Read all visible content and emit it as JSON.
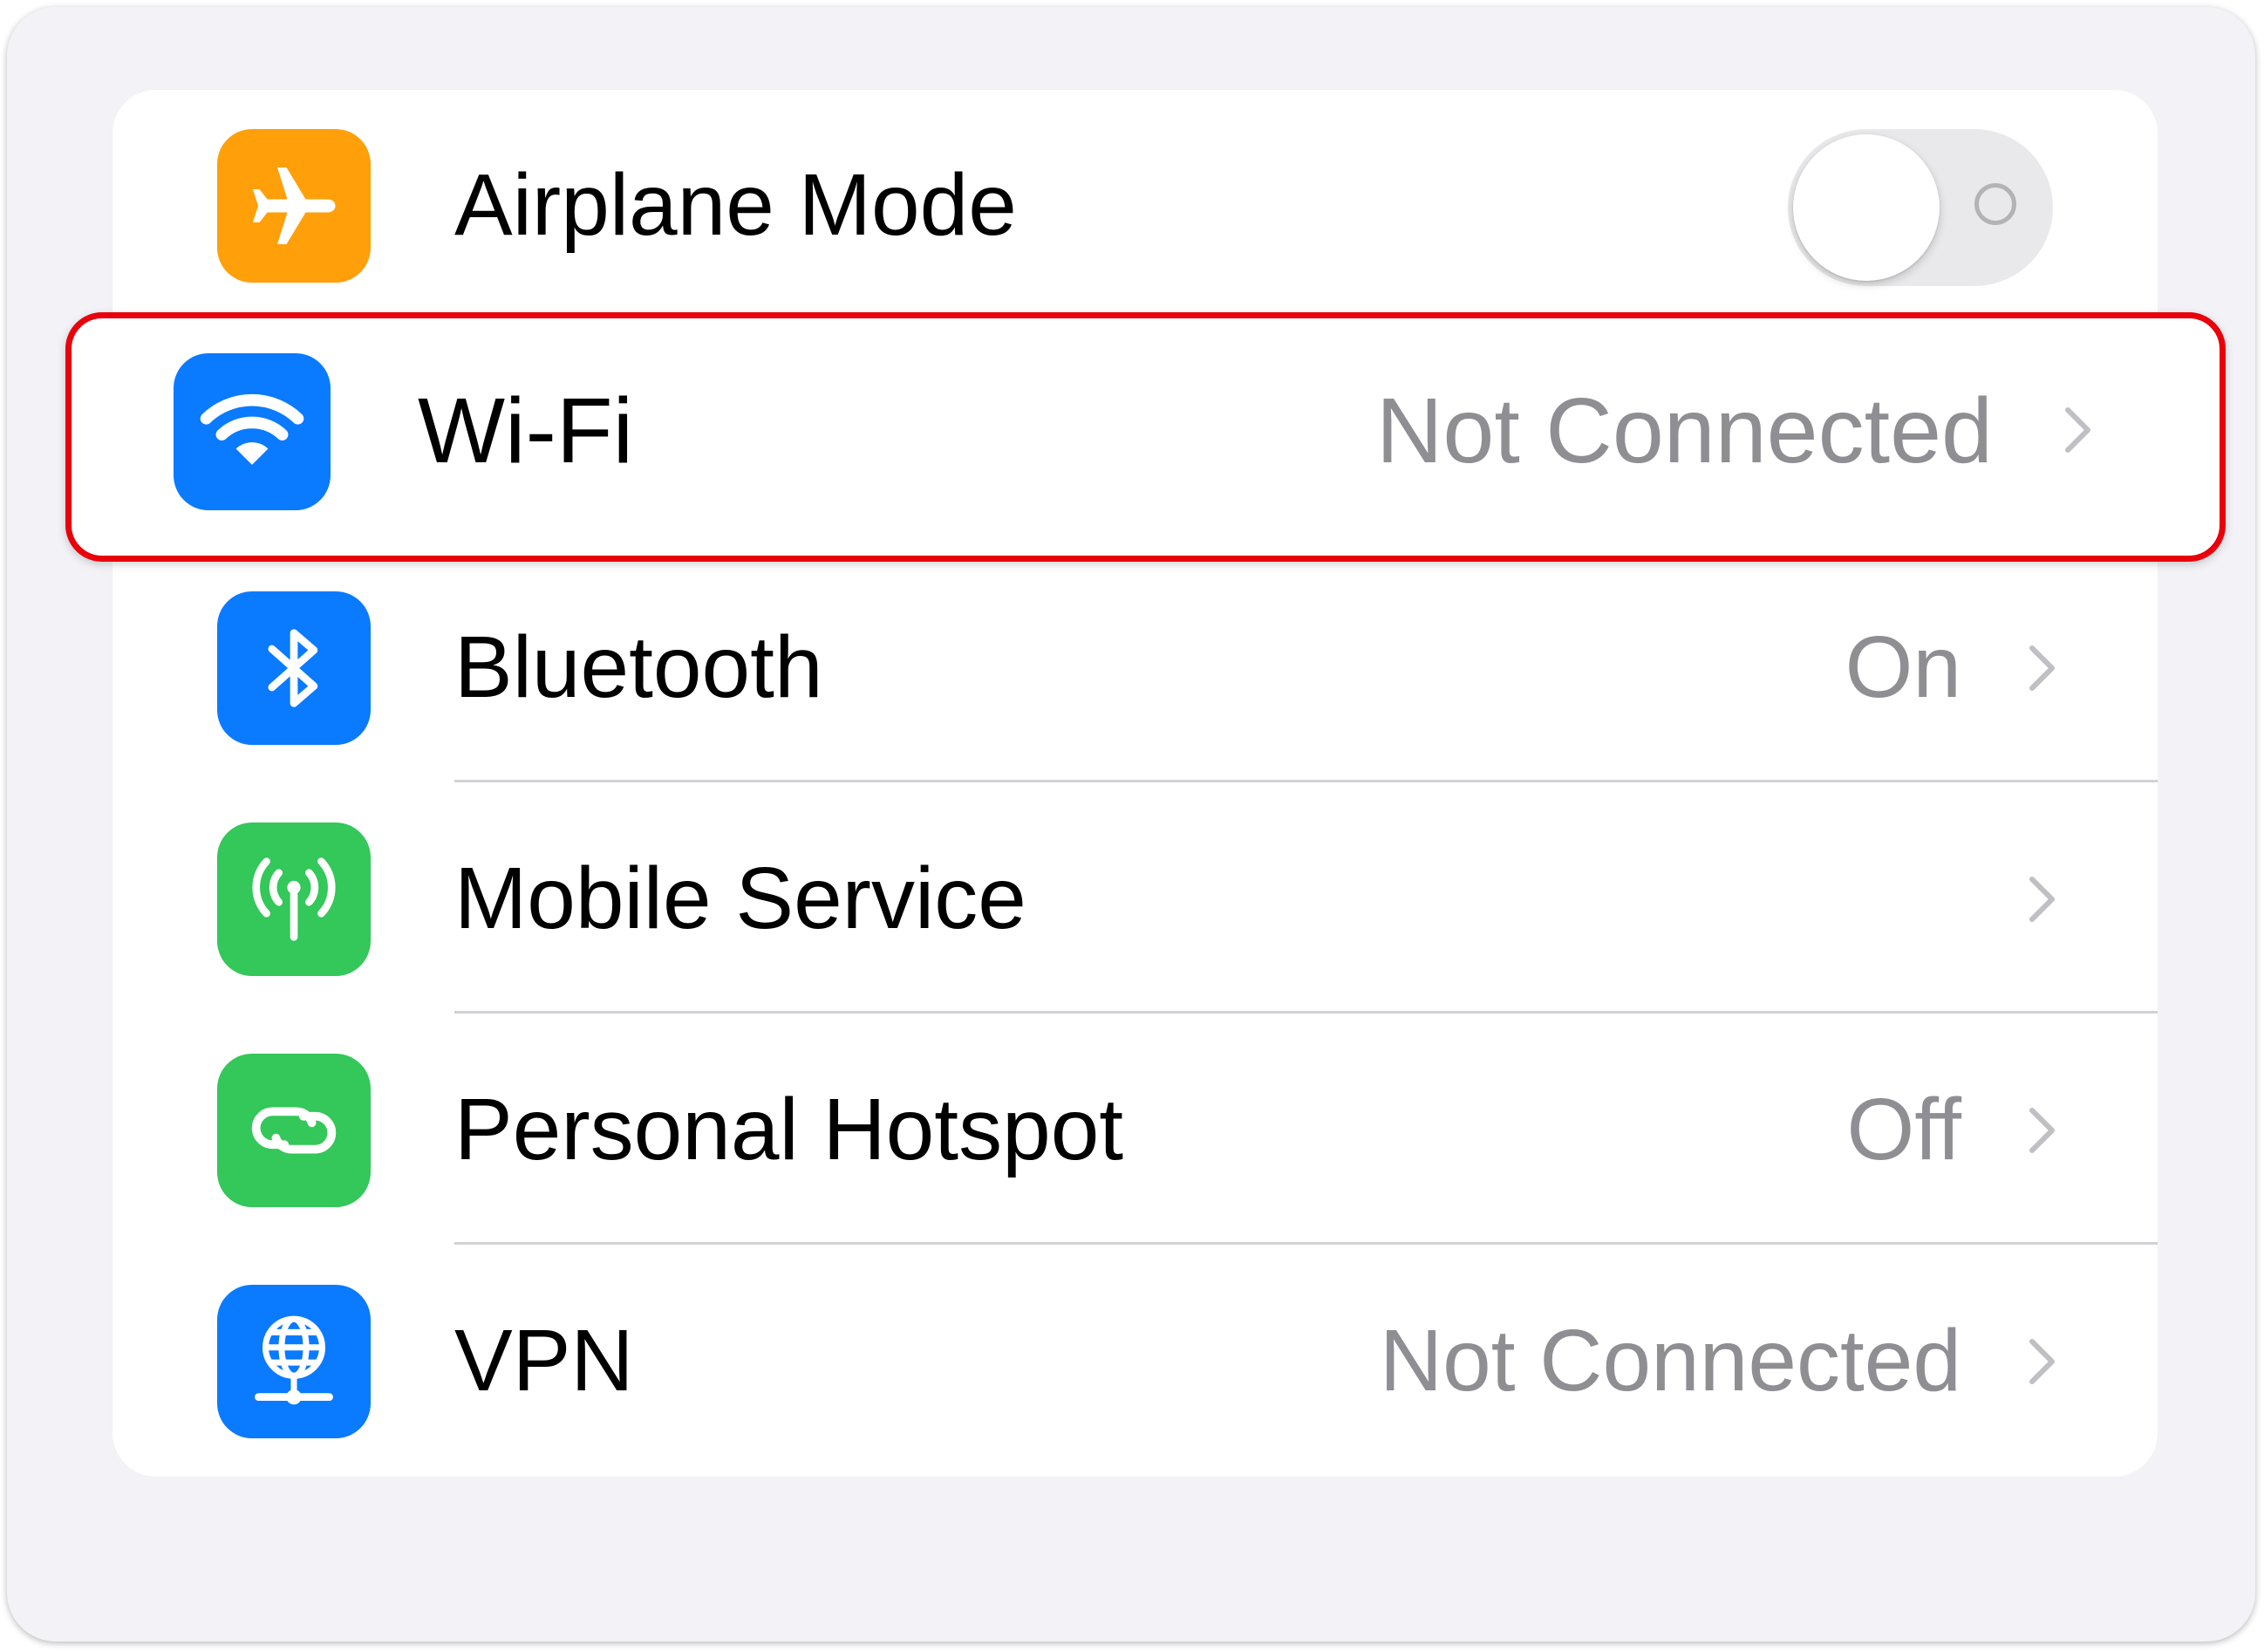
{
  "rows": {
    "airplane": {
      "label": "Airplane Mode",
      "toggle_on": false,
      "icon": "airplane-icon",
      "color": "#ff9f0a"
    },
    "wifi": {
      "label": "Wi-Fi",
      "value": "Not Connected",
      "icon": "wifi-icon",
      "color": "#0a7aff"
    },
    "bluetooth": {
      "label": "Bluetooth",
      "value": "On",
      "icon": "bluetooth-icon",
      "color": "#0a7aff"
    },
    "mobile": {
      "label": "Mobile Service",
      "value": "",
      "icon": "antenna-icon",
      "color": "#34c759"
    },
    "hotspot": {
      "label": "Personal Hotspot",
      "value": "Off",
      "icon": "link-icon",
      "color": "#34c759"
    },
    "vpn": {
      "label": "VPN",
      "value": "Not Connected",
      "icon": "globe-network-icon",
      "color": "#0a7aff"
    }
  },
  "highlight_color": "#e8000b"
}
